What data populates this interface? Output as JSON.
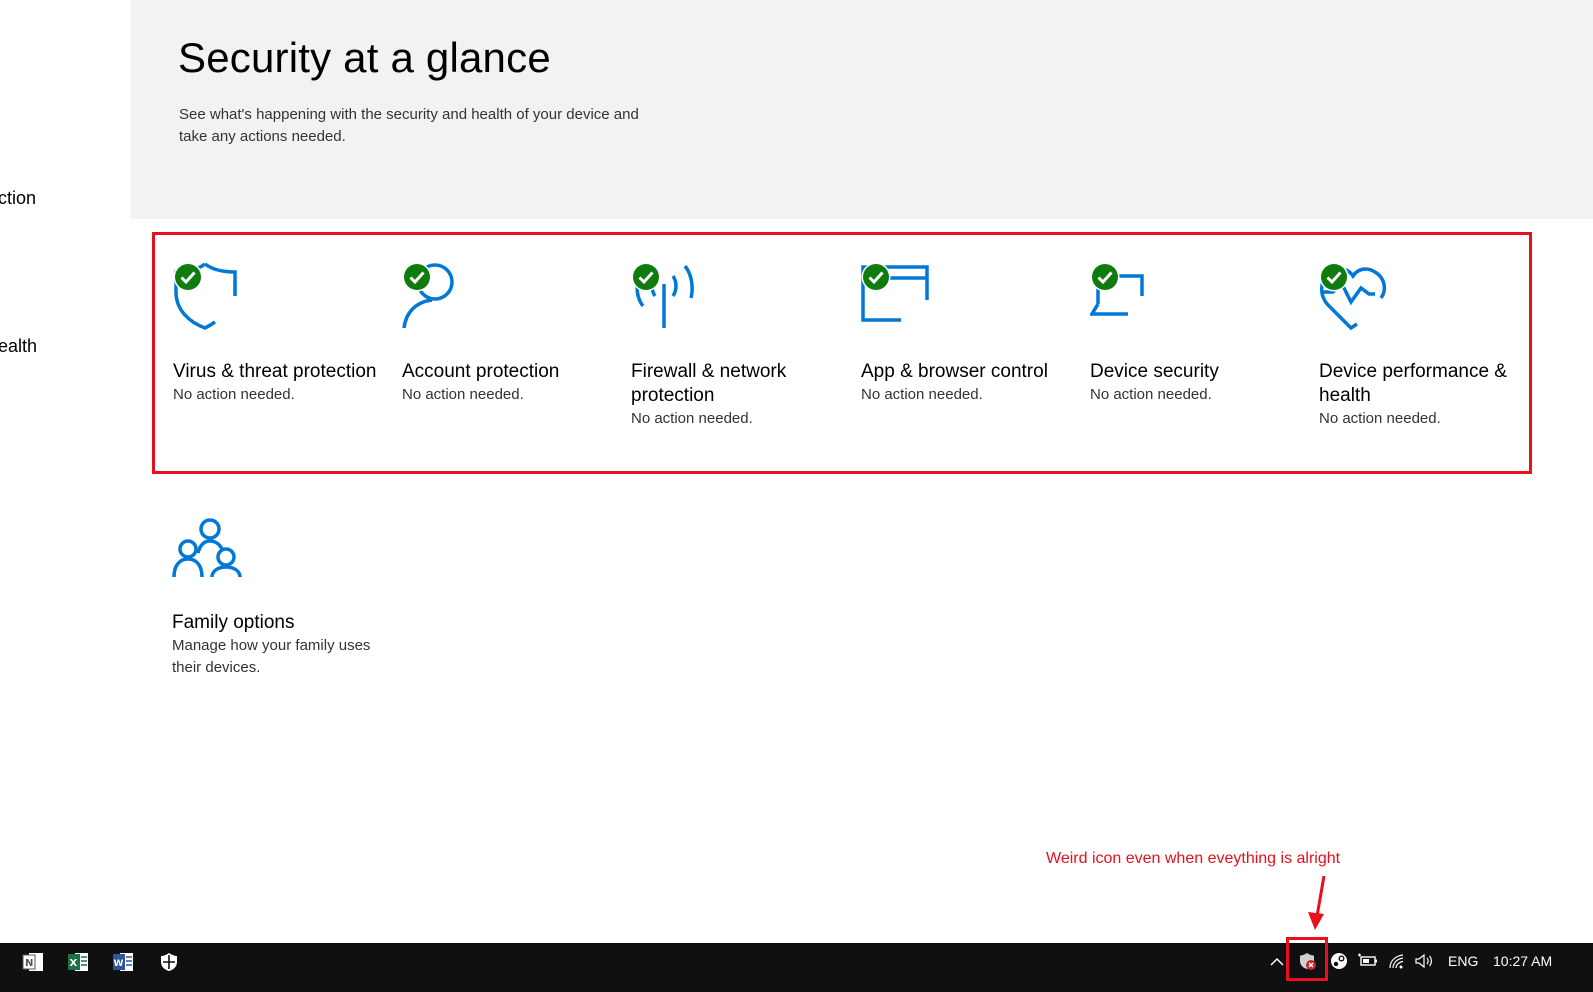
{
  "nav": {
    "items": [
      {
        "label": "ction"
      },
      {
        "label": "ealth"
      }
    ]
  },
  "header": {
    "title": "Security at a glance",
    "subtitle": "See what's happening with the security and health of your device and take any actions needed."
  },
  "tiles": [
    {
      "icon": "shield-icon",
      "title": "Virus & threat protection",
      "status": "No action needed."
    },
    {
      "icon": "person-icon",
      "title": "Account protection",
      "status": "No action needed."
    },
    {
      "icon": "antenna-icon",
      "title": "Firewall & network protection",
      "status": "No action needed."
    },
    {
      "icon": "browser-window-icon",
      "title": "App & browser control",
      "status": "No action needed."
    },
    {
      "icon": "laptop-icon",
      "title": "Device security",
      "status": "No action needed."
    },
    {
      "icon": "heart-pulse-icon",
      "title": "Device performance & health",
      "status": "No action needed."
    }
  ],
  "family": {
    "icon": "family-icon",
    "title": "Family options",
    "status": "Manage how your family uses their devices."
  },
  "annotation": {
    "text": "Weird icon even when eveything is alright"
  },
  "taskbar": {
    "apps": [
      "onenote-icon",
      "excel-icon",
      "word-icon",
      "defender-icon"
    ],
    "tray": {
      "language": "ENG",
      "time": "10:27 AM"
    }
  },
  "colors": {
    "accent": "#0078d7",
    "ok": "#107c10",
    "annotation": "#e8101e",
    "hero_bg": "#f2f2f2",
    "taskbar_bg": "#101010"
  }
}
